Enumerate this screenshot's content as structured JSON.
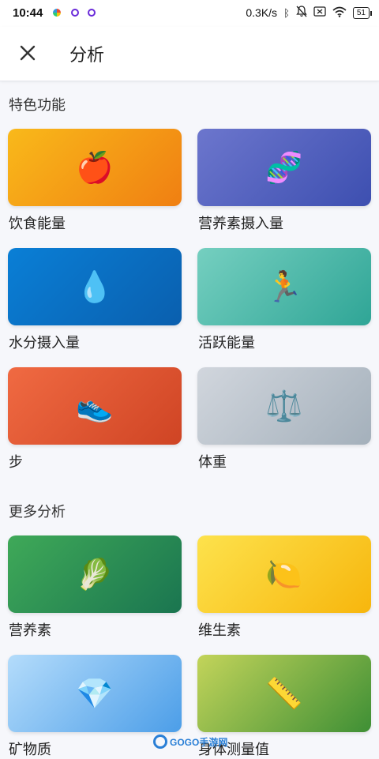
{
  "status_bar": {
    "time": "10:44",
    "net_speed": "0.3K/s",
    "battery": "51",
    "icons": [
      "app-notification-icon",
      "app-notification-icon",
      "app-notification-icon",
      "bluetooth-icon",
      "mute-bell-icon",
      "no-sim-icon",
      "wifi-icon",
      "battery-icon"
    ]
  },
  "header": {
    "close_icon": "close-icon",
    "title": "分析"
  },
  "sections": {
    "featured": {
      "title": "特色功能",
      "items": [
        {
          "label": "饮食能量",
          "icon": "apple-icon",
          "emoji": "🍎",
          "colors": [
            "#f9b91a",
            "#f07f12"
          ]
        },
        {
          "label": "营养素摄入量",
          "icon": "dna-icon",
          "emoji": "🧬",
          "colors": [
            "#6c76cd",
            "#3d4fb0"
          ]
        },
        {
          "label": "水分摄入量",
          "icon": "water-drop-icon",
          "emoji": "💧",
          "colors": [
            "#0a7fd6",
            "#0a5fae"
          ]
        },
        {
          "label": "活跃能量",
          "icon": "running-person-icon",
          "emoji": "🏃",
          "colors": [
            "#75cfc0",
            "#2fa596"
          ]
        },
        {
          "label": "步",
          "icon": "sneaker-icon",
          "emoji": "👟",
          "colors": [
            "#f06a42",
            "#cf4424"
          ]
        },
        {
          "label": "体重",
          "icon": "balance-scale-icon",
          "emoji": "⚖️",
          "colors": [
            "#d1d6dd",
            "#a4b0bb"
          ]
        }
      ]
    },
    "more": {
      "title": "更多分析",
      "items": [
        {
          "label": "营养素",
          "icon": "leafy-green-icon",
          "emoji": "🥬",
          "colors": [
            "#3fa958",
            "#1a7550"
          ]
        },
        {
          "label": "维生素",
          "icon": "lemon-icon",
          "emoji": "🍋",
          "colors": [
            "#fde24c",
            "#f7b60d"
          ]
        },
        {
          "label": "矿物质",
          "icon": "gem-icon",
          "emoji": "💎",
          "colors": [
            "#b4dcfb",
            "#4c9ee8"
          ]
        },
        {
          "label": "身体测量值",
          "icon": "ruler-icon",
          "emoji": "📏",
          "colors": [
            "#c3d45a",
            "#3e8f35"
          ]
        }
      ]
    }
  },
  "watermark": {
    "text": "GOGO手游网"
  }
}
